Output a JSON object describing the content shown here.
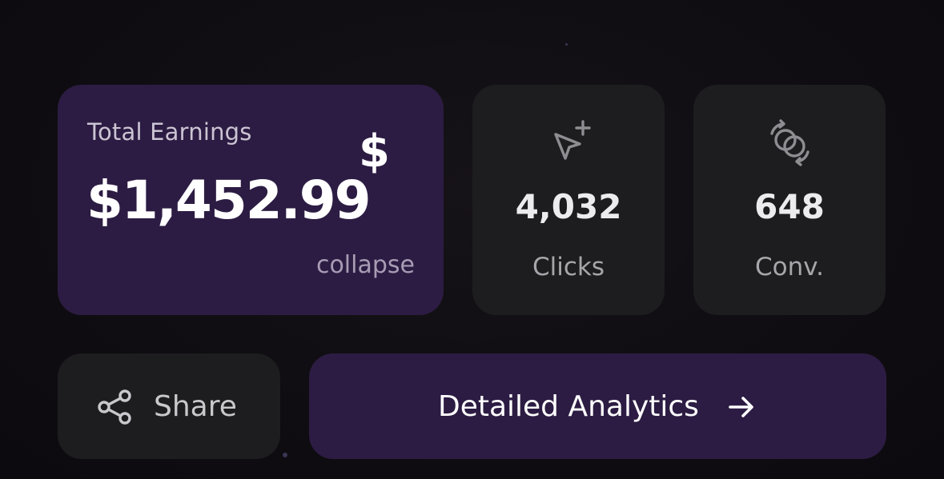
{
  "earnings": {
    "title": "Total Earnings",
    "amount": "$1,452.99",
    "currency_icon": "dollar-sign-icon",
    "collapse_label": "collapse"
  },
  "stats": [
    {
      "value": "4,032",
      "label": "Clicks",
      "icon": "cursor-click-plus-icon"
    },
    {
      "value": "648",
      "label": "Conv.",
      "icon": "conversion-rings-icon"
    }
  ],
  "actions": {
    "share_label": "Share",
    "share_icon": "share-icon",
    "analytics_label": "Detailed Analytics",
    "analytics_icon": "arrow-right-icon"
  },
  "colors": {
    "background": "#0f0d11",
    "accent_card": "#2c1c43",
    "neutral_card": "#1d1c1f"
  }
}
